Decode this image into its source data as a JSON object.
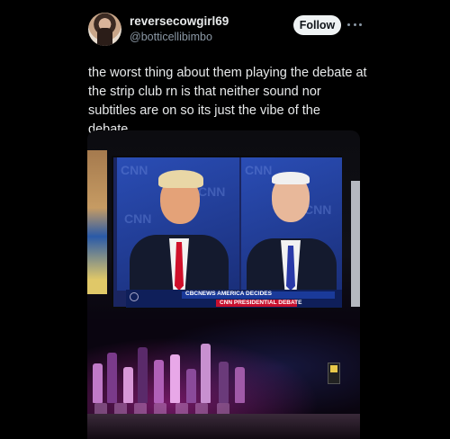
{
  "author": {
    "display_name": "reversecowgirl69",
    "handle": "@botticellibimbo"
  },
  "actions": {
    "follow_label": "Follow"
  },
  "tweet": {
    "text": "the worst thing about them playing the debate at the strip club rn is that neither sound nor subtitles are on so its just the vibe of the debate."
  },
  "media": {
    "tv_chyron_line1": "CBCNEWS AMERICA DECIDES",
    "tv_chyron_line2": "CNN PRESIDENTIAL DEBATE"
  },
  "icons": {
    "more": "more-dots-icon"
  },
  "colors": {
    "background": "#000000",
    "follow_button_bg": "#eff3f4",
    "secondary_text": "#8b98a5"
  }
}
